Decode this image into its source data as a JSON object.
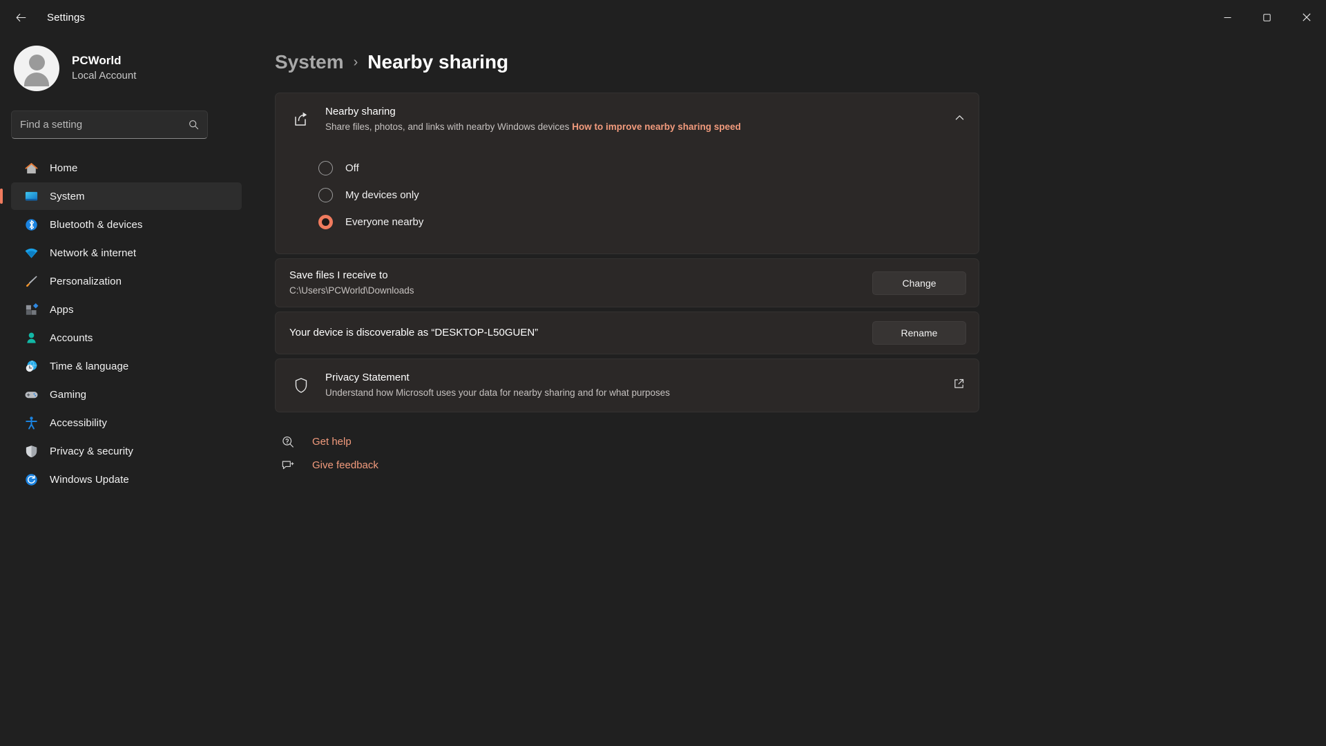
{
  "window": {
    "app_title": "Settings",
    "back_icon": "back-arrow-icon",
    "minimize_label": "─",
    "maximize_label": "❐",
    "close_label": "✕"
  },
  "account": {
    "name": "PCWorld",
    "subtitle": "Local Account",
    "avatar_icon": "user-avatar-icon"
  },
  "search": {
    "placeholder": "Find a setting",
    "value": "",
    "icon": "search-icon"
  },
  "sidebar": {
    "items": [
      {
        "label": "Home",
        "icon": "home-icon",
        "active": false
      },
      {
        "label": "System",
        "icon": "system-monitor-icon",
        "active": true
      },
      {
        "label": "Bluetooth & devices",
        "icon": "bluetooth-icon",
        "active": false
      },
      {
        "label": "Network & internet",
        "icon": "wifi-icon",
        "active": false
      },
      {
        "label": "Personalization",
        "icon": "paintbrush-icon",
        "active": false
      },
      {
        "label": "Apps",
        "icon": "apps-grid-icon",
        "active": false
      },
      {
        "label": "Accounts",
        "icon": "person-icon",
        "active": false
      },
      {
        "label": "Time & language",
        "icon": "clock-globe-icon",
        "active": false
      },
      {
        "label": "Gaming",
        "icon": "gamepad-icon",
        "active": false
      },
      {
        "label": "Accessibility",
        "icon": "accessibility-icon",
        "active": false
      },
      {
        "label": "Privacy & security",
        "icon": "shield-icon",
        "active": false
      },
      {
        "label": "Windows Update",
        "icon": "update-refresh-icon",
        "active": false
      }
    ]
  },
  "breadcrumb": {
    "parent": "System",
    "separator": "›",
    "current": "Nearby sharing"
  },
  "nearby_sharing_card": {
    "icon": "share-icon",
    "title": "Nearby sharing",
    "subtitle": "Share files, photos, and links with nearby Windows devices",
    "link_text": "How to improve nearby sharing speed",
    "expand_icon": "chevron-up-icon",
    "expanded": true,
    "options": [
      {
        "label": "Off",
        "selected": false
      },
      {
        "label": "My devices only",
        "selected": false
      },
      {
        "label": "Everyone nearby",
        "selected": true
      }
    ]
  },
  "save_location_row": {
    "title": "Save files I receive to",
    "path": "C:\\Users\\PCWorld\\Downloads",
    "button_label": "Change"
  },
  "device_name_row": {
    "title": "Your device is discoverable as “DESKTOP-L50GUEN”",
    "button_label": "Rename"
  },
  "privacy_row": {
    "icon": "shield-outline-icon",
    "title": "Privacy Statement",
    "subtitle": "Understand how Microsoft uses your data for nearby sharing and for what purposes",
    "external_icon": "external-link-icon"
  },
  "footer_links": [
    {
      "label": "Get help",
      "icon": "help-icon"
    },
    {
      "label": "Give feedback",
      "icon": "feedback-icon"
    }
  ],
  "colors": {
    "accent": "#f07b5e",
    "link": "#f29b7d",
    "window_bg": "#202020",
    "card_bg": "#2b2827"
  }
}
